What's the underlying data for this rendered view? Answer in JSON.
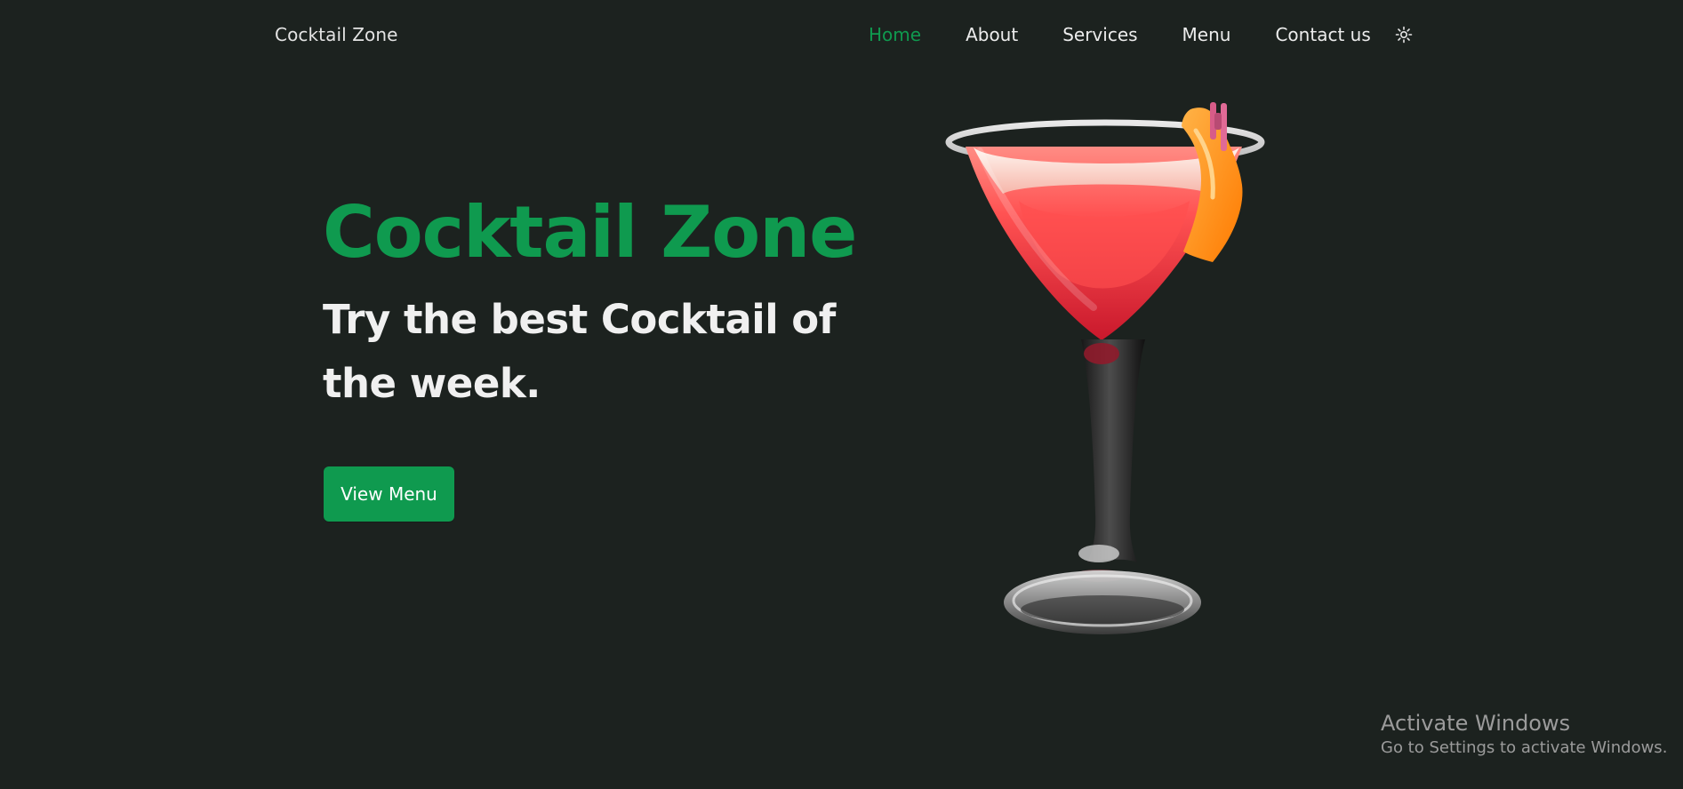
{
  "header": {
    "brand": "Cocktail Zone",
    "nav": [
      "Home",
      "About",
      "Services",
      "Menu",
      "Contact us"
    ]
  },
  "hero": {
    "title": "Cocktail Zone",
    "subtitle": "Try the best Cocktail of the week.",
    "button": "View Menu"
  },
  "icons": {
    "theme_toggle": "sun-icon"
  },
  "system": {
    "activate_title": "Activate Windows",
    "activate_text": "Go to Settings to activate Windows."
  },
  "colors": {
    "background": "#1c221f",
    "accent": "#0f9a4f",
    "text": "#f0f0f0"
  }
}
